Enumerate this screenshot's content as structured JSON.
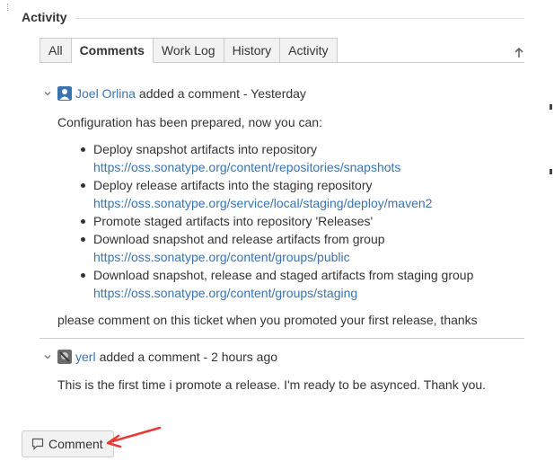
{
  "section": {
    "title": "Activity"
  },
  "tabs": [
    {
      "label": "All",
      "active": false
    },
    {
      "label": "Comments",
      "active": true
    },
    {
      "label": "Work Log",
      "active": false
    },
    {
      "label": "History",
      "active": false
    },
    {
      "label": "Activity",
      "active": false
    }
  ],
  "sort_icon": "arrow-up-icon",
  "comments": [
    {
      "author": "Joel Orlina",
      "action": "added a comment - Yesterday",
      "avatar": "user-avatar-icon",
      "intro": "Configuration has been prepared, now you can:",
      "items": [
        {
          "text": "Deploy snapshot artifacts into repository",
          "link": "https://oss.sonatype.org/content/repositories/snapshots"
        },
        {
          "text": "Deploy release artifacts into the staging repository",
          "link": "https://oss.sonatype.org/service/local/staging/deploy/maven2"
        },
        {
          "text": "Promote staged artifacts into repository 'Releases'",
          "link": ""
        },
        {
          "text": "Download snapshot and release artifacts from group",
          "link": "https://oss.sonatype.org/content/groups/public"
        },
        {
          "text": "Download snapshot, release and staged artifacts from staging group",
          "link": "https://oss.sonatype.org/content/groups/staging"
        }
      ],
      "outro": "please comment on this ticket when you promoted your first release, thanks"
    },
    {
      "author": "yerl",
      "action": "added a comment - 2 hours ago",
      "avatar": "user-photo-avatar",
      "body": "This is the first time i promote a release. I'm ready to be asynced. Thank you."
    }
  ],
  "comment_button": {
    "label": "Comment",
    "icon": "speech-bubble-icon"
  },
  "colors": {
    "link": "#3b73af",
    "text": "#333333",
    "tab_bg": "#f2f2f2",
    "border": "#cccccc",
    "annotation_arrow": "#e53935"
  }
}
